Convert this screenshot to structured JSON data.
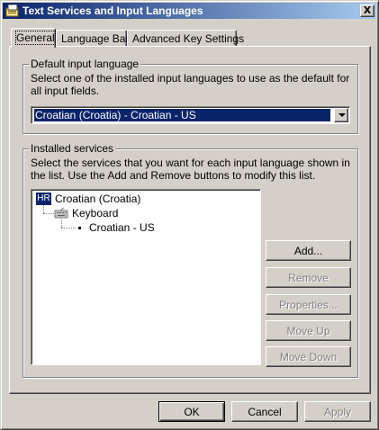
{
  "window": {
    "title": "Text Services and Input Languages",
    "close_glyph": "X"
  },
  "tabs": [
    {
      "label": "General",
      "active": true
    },
    {
      "label": "Language Bar",
      "active": false
    },
    {
      "label": "Advanced Key Settings",
      "active": false
    }
  ],
  "default_language": {
    "group_title": "Default input language",
    "description": "Select one of the installed input languages to use as the default for all input fields.",
    "selected": "Croatian (Croatia) - Croatian - US"
  },
  "installed_services": {
    "group_title": "Installed services",
    "description": "Select the services that you want for each input language shown in the list. Use the Add and Remove buttons to modify this list.",
    "tree": {
      "language_badge": "HR",
      "language": "Croatian (Croatia)",
      "category": "Keyboard",
      "layout": "Croatian - US"
    },
    "buttons": {
      "add": "Add...",
      "remove": "Remove",
      "properties": "Properties...",
      "move_up": "Move Up",
      "move_down": "Move Down"
    }
  },
  "footer": {
    "ok": "OK",
    "cancel": "Cancel",
    "apply": "Apply"
  },
  "colors": {
    "face": "#d4d0c8",
    "title_gradient_start": "#0a246a",
    "title_gradient_end": "#a6caf0",
    "selection": "#0a246a"
  },
  "icons": [
    "text-services-icon",
    "keyboard-icon",
    "dropdown-arrow-icon"
  ]
}
